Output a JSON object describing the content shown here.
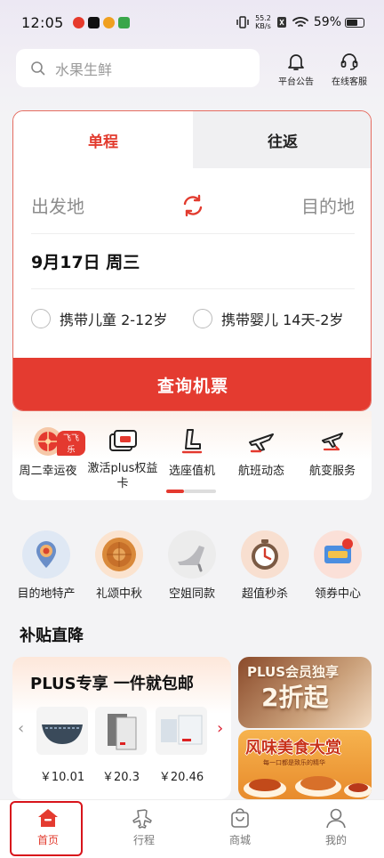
{
  "status_bar": {
    "time": "12:05",
    "net_speed_value": "55.2",
    "net_speed_unit": "KB/s",
    "battery": "59%"
  },
  "search": {
    "placeholder": "水果生鲜"
  },
  "top_actions": {
    "announcement": "平台公告",
    "customer_service": "在线客服"
  },
  "ticket": {
    "tab_oneway": "单程",
    "tab_roundtrip": "往返",
    "origin": "出发地",
    "destination": "目的地",
    "date": "9月17日 周三",
    "option_child": "携带儿童 2-12岁",
    "option_infant": "携带婴儿 14天-2岁",
    "search_button": "查询机票"
  },
  "services": {
    "items": [
      {
        "label": "周二幸运夜",
        "badge": "飞飞乐"
      },
      {
        "label": "激活plus权益卡"
      },
      {
        "label": "选座值机"
      },
      {
        "label": "航班动态"
      },
      {
        "label": "航变服务"
      }
    ]
  },
  "categories": {
    "items": [
      {
        "label": "目的地特产"
      },
      {
        "label": "礼颂中秋"
      },
      {
        "label": "空姐同款"
      },
      {
        "label": "超值秒杀"
      },
      {
        "label": "领券中心"
      }
    ]
  },
  "section": {
    "title": "补贴直降"
  },
  "promo_left": {
    "title": "PLUS专享 一件就包邮",
    "products": [
      {
        "price": "￥10.01"
      },
      {
        "price": "￥20.3"
      },
      {
        "price": "￥20.46"
      }
    ]
  },
  "promo_right": {
    "top_line1": "PLUS会员独享",
    "top_line2": "2折起",
    "bottom_line1": "风味美食大赏",
    "bottom_line2": "每一口都是致乐的精华"
  },
  "bottom_nav": {
    "home": "首页",
    "trips": "行程",
    "mall": "商城",
    "mine": "我的"
  },
  "colors": {
    "accent": "#e43b30",
    "highlight_box": "#d8141b"
  }
}
